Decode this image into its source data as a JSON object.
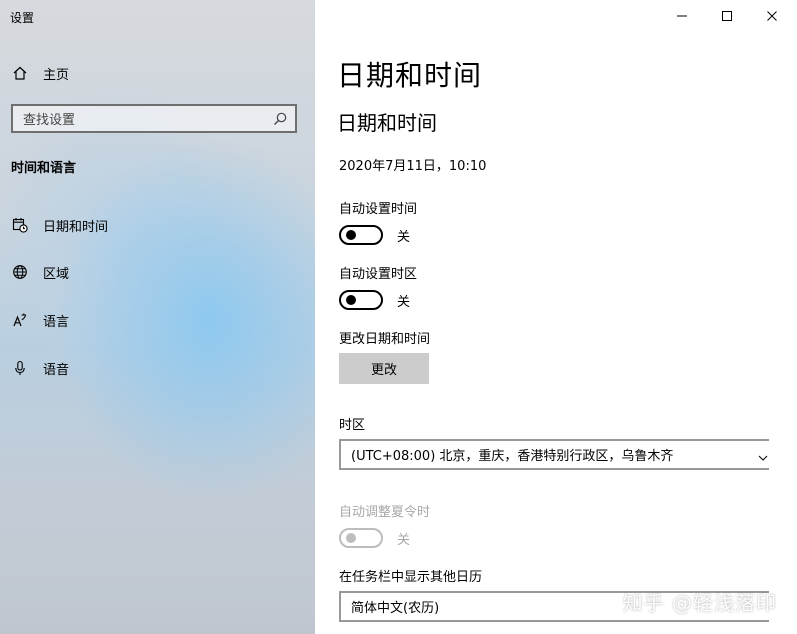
{
  "window": {
    "title": "设置",
    "controls": {
      "minimize": "minimize-icon",
      "maximize": "maximize-icon",
      "close": "close-icon"
    }
  },
  "sidebar": {
    "home_label": "主页",
    "search_placeholder": "查找设置",
    "section_title": "时间和语言",
    "items": [
      {
        "label": "日期和时间",
        "icon": "calendar-clock-icon"
      },
      {
        "label": "区域",
        "icon": "globe-icon"
      },
      {
        "label": "语言",
        "icon": "language-icon"
      },
      {
        "label": "语音",
        "icon": "microphone-icon"
      }
    ]
  },
  "main": {
    "page_title": "日期和时间",
    "section_title": "日期和时间",
    "current_datetime": "2020年7月11日，10:10",
    "auto_time": {
      "label": "自动设置时间",
      "state": "关"
    },
    "auto_timezone": {
      "label": "自动设置时区",
      "state": "关"
    },
    "change_datetime": {
      "label": "更改日期和时间",
      "button": "更改"
    },
    "timezone": {
      "label": "时区",
      "value": "(UTC+08:00) 北京，重庆，香港特别行政区，乌鲁木齐"
    },
    "dst": {
      "label": "自动调整夏令时",
      "state": "关"
    },
    "other_calendar": {
      "label": "在任务栏中显示其他日历",
      "value": "简体中文(农历)"
    }
  },
  "watermark": "知乎 @轻浅落印"
}
